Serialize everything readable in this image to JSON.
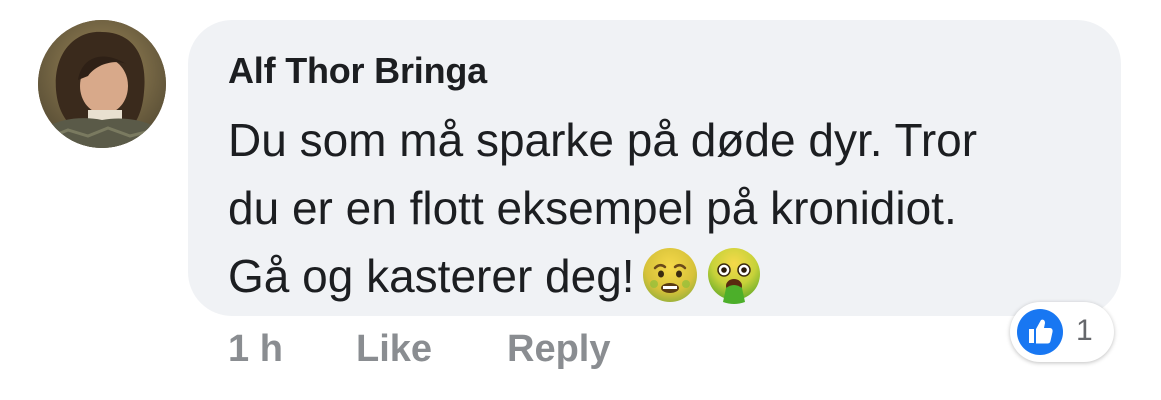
{
  "comment": {
    "author": "Alf Thor Bringa",
    "body_lines": [
      "Du som må sparke på døde dyr. Tror",
      "du er en flott eksempel på kronidiot.",
      "Gå og kasterer deg!"
    ],
    "emojis": [
      "nauseated-face",
      "vomiting-face"
    ]
  },
  "actions": {
    "time": "1 h",
    "like_label": "Like",
    "reply_label": "Reply"
  },
  "reactions": {
    "icon": "thumbs-up-icon",
    "count": "1",
    "color": "#1877f2"
  },
  "colors": {
    "bubble": "#f0f2f5",
    "text": "#1c1e21",
    "meta": "#8a8d91"
  }
}
